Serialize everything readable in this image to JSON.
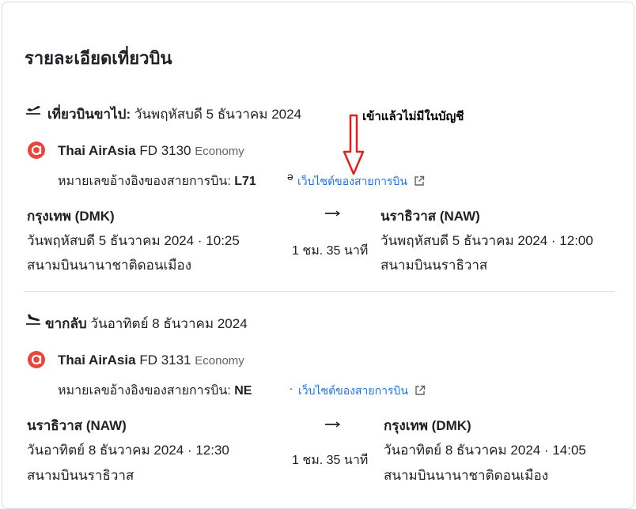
{
  "page_title": "รายละเอียดเที่ยวบิน",
  "annotation": {
    "text": "เข้าแล้วไม่มีในบัญชี",
    "arrow_color": "#e02020"
  },
  "colors": {
    "link": "#1a73e8",
    "airline_logo": "#e8453c",
    "divider": "#dadce0"
  },
  "outbound": {
    "icon": "takeoff-icon",
    "label": "เที่ยวบินขาไป:",
    "date": "วันพฤหัสบดี 5 ธันวาคม 2024",
    "airline": "Thai AirAsia",
    "flight_no": "FD 3130",
    "cabin": "Economy",
    "ref_label": "หมายเลขอ้างอิงของสายการบิน:",
    "ref_value": "L71",
    "ref_value_tail": "ə",
    "website_label": "เว็บไซต์ของสายการบิน",
    "departure": {
      "airport": "กรุงเทพ (DMK)",
      "datetime": "วันพฤหัสบดี 5 ธันวาคม 2024 · 10:25",
      "airport_name": "สนามบินนานาชาติดอนเมือง"
    },
    "duration": "1 ชม. 35 นาที",
    "arrival": {
      "airport": "นราธิวาส (NAW)",
      "datetime": "วันพฤหัสบดี 5 ธันวาคม 2024 · 12:00",
      "airport_name": "สนามบินนราธิวาส"
    }
  },
  "return": {
    "icon": "landing-icon",
    "label": "ขากลับ",
    "date": "วันอาทิตย์ 8 ธันวาคม 2024",
    "airline": "Thai AirAsia",
    "flight_no": "FD 3131",
    "cabin": "Economy",
    "ref_label": "หมายเลขอ้างอิงของสายการบิน:",
    "ref_value": "NE",
    "ref_value_tail": ".",
    "website_label": "เว็บไซต์ของสายการบิน",
    "departure": {
      "airport": "นราธิวาส (NAW)",
      "datetime": "วันอาทิตย์ 8 ธันวาคม 2024 · 12:30",
      "airport_name": "สนามบินนราธิวาส"
    },
    "duration": "1 ชม. 35 นาที",
    "arrival": {
      "airport": "กรุงเทพ (DMK)",
      "datetime": "วันอาทิตย์ 8 ธันวาคม 2024 · 14:05",
      "airport_name": "สนามบินนานาชาติดอนเมือง"
    }
  }
}
